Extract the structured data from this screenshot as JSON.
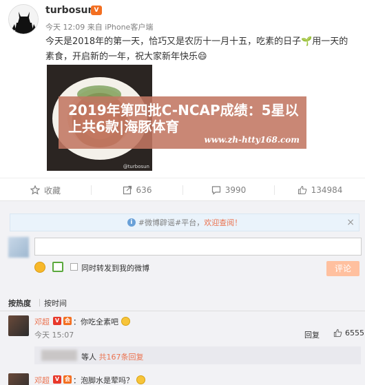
{
  "post": {
    "username": "turbosun",
    "meta": "今天 12:09 来自 iPhone客户端",
    "content": "今天是2018年的第一天，恰巧又是农历十一月十五，吃素的日子🌱用一天的素食，开启新的一年，祝大家新年快乐😄",
    "photo_watermark": "@turbosun",
    "overlay_title": "2019年第四批C-NCAP成绩：5星以上共6款|海豚体育",
    "overlay_url": "www.zh-htty168.com"
  },
  "actions": {
    "favorite": "收藏",
    "repost": "636",
    "comment": "3990",
    "like": "134984"
  },
  "comments": {
    "notice_prefix": "#微博辟谣#平台，",
    "notice_link": "欢迎查阅！",
    "repost_also": "同时转发到我的微博",
    "submit": "评论",
    "sort_hot": "按热度",
    "sort_time": "按时间",
    "items": [
      {
        "name": "邓超",
        "text": "：你吃全素吧",
        "time": "今天 15:07",
        "reply": "回复",
        "likes": "6555",
        "sub_people": "等人",
        "sub_count": "共167条回复"
      },
      {
        "name": "邓超",
        "text": "：泡脚水是荤吗？"
      }
    ]
  }
}
